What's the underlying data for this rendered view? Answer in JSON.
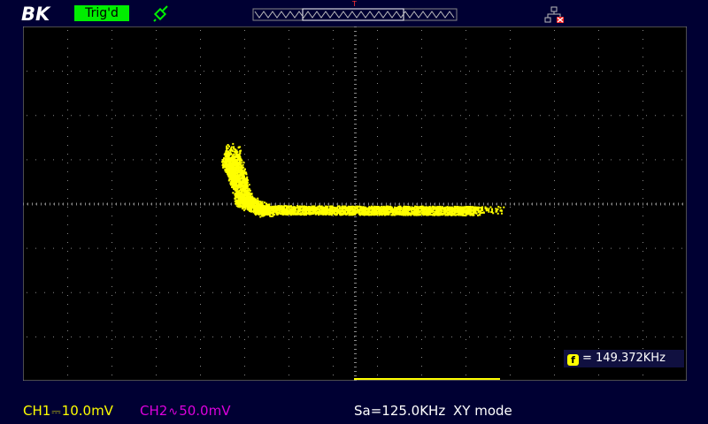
{
  "brand": {
    "logo_text": "BK"
  },
  "header": {
    "trigger_status": "Trig'd",
    "trigger_marker": "T"
  },
  "icons": {
    "probe": "probe-icon",
    "network": "network-disconnected-icon",
    "frequency": "frequency-counter-icon"
  },
  "measurement": {
    "frequency_icon": "f",
    "frequency_text": "= 149.372KHz"
  },
  "status_bar": {
    "ch1_label": "CH1",
    "ch1_coupling": "DC",
    "ch1_coupling_symbol": "⎓",
    "ch1_scale": "10.0mV",
    "ch2_label": "CH2",
    "ch2_coupling": "AC",
    "ch2_coupling_symbol": "∿",
    "ch2_scale": "50.0mV",
    "sample_rate": "Sa=125.0KHz",
    "mode": "XY mode"
  },
  "colors": {
    "background": "#000033",
    "screen": "#000000",
    "trace": "#ffff00",
    "ch1": "#ffff00",
    "ch2": "#dd00dd",
    "trigger_badge": "#00ee00",
    "grid_dot": "#888888"
  }
}
